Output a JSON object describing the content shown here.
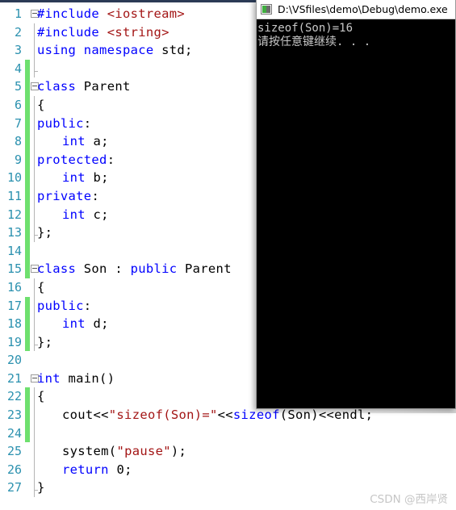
{
  "editor": {
    "line_number_color": "#2b91af",
    "change_bar_color": "#6ee06e",
    "keyword_color": "#0000ff",
    "string_color": "#a31515",
    "text_color": "#000000",
    "background": "#ffffff",
    "lines": [
      {
        "num": "1",
        "changed": false,
        "fold": "start",
        "guide": false,
        "indent": 0,
        "tokens": [
          {
            "t": "#include ",
            "c": "pp"
          },
          {
            "t": "<iostream>",
            "c": "str"
          }
        ]
      },
      {
        "num": "2",
        "changed": false,
        "fold": "none",
        "guide": true,
        "indent": 0,
        "tokens": [
          {
            "t": "#include ",
            "c": "pp"
          },
          {
            "t": "<string>",
            "c": "str"
          }
        ]
      },
      {
        "num": "3",
        "changed": false,
        "fold": "none",
        "guide": true,
        "indent": 0,
        "tokens": [
          {
            "t": "using namespace ",
            "c": "kw"
          },
          {
            "t": "std;",
            "c": "pl"
          }
        ]
      },
      {
        "num": "4",
        "changed": true,
        "fold": "none",
        "guide": "end",
        "indent": 0,
        "tokens": []
      },
      {
        "num": "5",
        "changed": true,
        "fold": "start",
        "guide": false,
        "indent": 0,
        "tokens": [
          {
            "t": "class ",
            "c": "kw"
          },
          {
            "t": "Parent",
            "c": "pl"
          }
        ]
      },
      {
        "num": "6",
        "changed": true,
        "fold": "none",
        "guide": true,
        "indent": 0,
        "tokens": [
          {
            "t": "{",
            "c": "pl"
          }
        ]
      },
      {
        "num": "7",
        "changed": true,
        "fold": "none",
        "guide": true,
        "indent": 0,
        "tokens": [
          {
            "t": "public",
            "c": "kw"
          },
          {
            "t": ":",
            "c": "pl"
          }
        ]
      },
      {
        "num": "8",
        "changed": true,
        "fold": "none",
        "guide": true,
        "indent": 1,
        "tokens": [
          {
            "t": "int ",
            "c": "kw"
          },
          {
            "t": "a;",
            "c": "pl"
          }
        ]
      },
      {
        "num": "9",
        "changed": true,
        "fold": "none",
        "guide": true,
        "indent": 0,
        "tokens": [
          {
            "t": "protected",
            "c": "kw"
          },
          {
            "t": ":",
            "c": "pl"
          }
        ]
      },
      {
        "num": "10",
        "changed": true,
        "fold": "none",
        "guide": true,
        "indent": 1,
        "tokens": [
          {
            "t": "int ",
            "c": "kw"
          },
          {
            "t": "b;",
            "c": "pl"
          }
        ]
      },
      {
        "num": "11",
        "changed": true,
        "fold": "none",
        "guide": true,
        "indent": 0,
        "tokens": [
          {
            "t": "private",
            "c": "kw"
          },
          {
            "t": ":",
            "c": "pl"
          }
        ]
      },
      {
        "num": "12",
        "changed": true,
        "fold": "none",
        "guide": true,
        "indent": 1,
        "tokens": [
          {
            "t": "int ",
            "c": "kw"
          },
          {
            "t": "c;",
            "c": "pl"
          }
        ]
      },
      {
        "num": "13",
        "changed": true,
        "fold": "none",
        "guide": "end",
        "indent": 0,
        "tokens": [
          {
            "t": "};",
            "c": "pl"
          }
        ]
      },
      {
        "num": "14",
        "changed": true,
        "fold": "none",
        "guide": false,
        "indent": 0,
        "tokens": []
      },
      {
        "num": "15",
        "changed": true,
        "fold": "start",
        "guide": false,
        "indent": 0,
        "tokens": [
          {
            "t": "class ",
            "c": "kw"
          },
          {
            "t": "Son : ",
            "c": "pl"
          },
          {
            "t": "public ",
            "c": "kw"
          },
          {
            "t": "Parent",
            "c": "pl"
          }
        ]
      },
      {
        "num": "16",
        "changed": false,
        "fold": "none",
        "guide": true,
        "indent": 0,
        "tokens": [
          {
            "t": "{",
            "c": "pl"
          }
        ]
      },
      {
        "num": "17",
        "changed": true,
        "fold": "none",
        "guide": true,
        "indent": 0,
        "tokens": [
          {
            "t": "public",
            "c": "kw"
          },
          {
            "t": ":",
            "c": "pl"
          }
        ]
      },
      {
        "num": "18",
        "changed": true,
        "fold": "none",
        "guide": true,
        "indent": 1,
        "tokens": [
          {
            "t": "int ",
            "c": "kw"
          },
          {
            "t": "d;",
            "c": "pl"
          }
        ]
      },
      {
        "num": "19",
        "changed": true,
        "fold": "none",
        "guide": "end",
        "indent": 0,
        "tokens": [
          {
            "t": "};",
            "c": "pl"
          }
        ]
      },
      {
        "num": "20",
        "changed": false,
        "fold": "none",
        "guide": false,
        "indent": 0,
        "tokens": []
      },
      {
        "num": "21",
        "changed": false,
        "fold": "start",
        "guide": false,
        "indent": 0,
        "tokens": [
          {
            "t": "int ",
            "c": "kw"
          },
          {
            "t": "main()",
            "c": "pl"
          }
        ]
      },
      {
        "num": "22",
        "changed": true,
        "fold": "none",
        "guide": true,
        "indent": 0,
        "tokens": [
          {
            "t": "{",
            "c": "pl"
          }
        ]
      },
      {
        "num": "23",
        "changed": true,
        "fold": "none",
        "guide": true,
        "indent": 1,
        "tokens": [
          {
            "t": "cout<<",
            "c": "pl"
          },
          {
            "t": "\"sizeof(Son)=\"",
            "c": "str"
          },
          {
            "t": "<<",
            "c": "pl"
          },
          {
            "t": "sizeof",
            "c": "kw"
          },
          {
            "t": "(Son)<<endl;",
            "c": "pl"
          }
        ]
      },
      {
        "num": "24",
        "changed": true,
        "fold": "none",
        "guide": true,
        "indent": 0,
        "tokens": []
      },
      {
        "num": "25",
        "changed": false,
        "fold": "none",
        "guide": true,
        "indent": 1,
        "tokens": [
          {
            "t": "system(",
            "c": "pl"
          },
          {
            "t": "\"pause\"",
            "c": "str"
          },
          {
            "t": ");",
            "c": "pl"
          }
        ]
      },
      {
        "num": "26",
        "changed": false,
        "fold": "none",
        "guide": true,
        "indent": 1,
        "tokens": [
          {
            "t": "return ",
            "c": "kw"
          },
          {
            "t": "0;",
            "c": "pl"
          }
        ]
      },
      {
        "num": "27",
        "changed": false,
        "fold": "none",
        "guide": "end",
        "indent": 0,
        "tokens": [
          {
            "t": "}",
            "c": "pl"
          }
        ]
      }
    ]
  },
  "console": {
    "title": "D:\\VSfiles\\demo\\Debug\\demo.exe",
    "icon": "console-app-icon",
    "background": "#000000",
    "text_color": "#c8c8c8",
    "output": [
      "sizeof(Son)=16",
      "请按任意键继续. . ."
    ]
  },
  "watermark": {
    "text": "CSDN @西岸贤",
    "color": "#c6c6c6"
  }
}
